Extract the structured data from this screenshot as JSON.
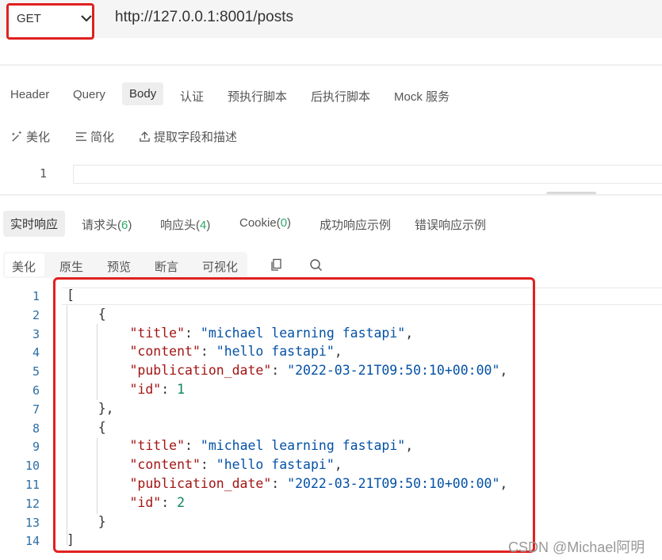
{
  "request": {
    "method": "GET",
    "url": "http://127.0.0.1:8001/posts"
  },
  "request_tabs": [
    "Header",
    "Query",
    "Body",
    "认证",
    "预执行脚本",
    "后执行脚本",
    "Mock 服务"
  ],
  "active_request_tab": "Body",
  "tools": {
    "beautify": "美化",
    "simplify": "简化",
    "extract": "提取字段和描述"
  },
  "request_editor": {
    "line_number": "1"
  },
  "response_tabs": {
    "realtime": "实时响应",
    "request_headers_label": "请求头(",
    "request_headers_count": "6",
    "response_headers_label": "响应头(",
    "response_headers_count": "4",
    "cookie_label": "Cookie(",
    "cookie_count": "0",
    "close_paren": ")",
    "success_example": "成功响应示例",
    "error_example": "错误响应示例"
  },
  "view_tabs": [
    "美化",
    "原生",
    "预览",
    "断言",
    "可视化"
  ],
  "active_view_tab": "美化",
  "icons": [
    "chevron-down-icon",
    "magic-wand-icon",
    "list-icon",
    "upload-icon",
    "copy-icon",
    "search-icon"
  ],
  "response_body": [
    {
      "title": "michael learning fastapi",
      "content": "hello fastapi",
      "publication_date": "2022-03-21T09:50:10+00:00",
      "id": 1
    },
    {
      "title": "michael learning fastapi",
      "content": "hello fastapi",
      "publication_date": "2022-03-21T09:50:10+00:00",
      "id": 2
    }
  ],
  "code_lines": [
    {
      "n": "1",
      "parts": [
        {
          "t": "["
        }
      ]
    },
    {
      "n": "2",
      "parts": [
        {
          "t": "    {"
        }
      ]
    },
    {
      "n": "3",
      "parts": [
        {
          "t": "        "
        },
        {
          "t": "\"title\"",
          "c": "k"
        },
        {
          "t": ": "
        },
        {
          "t": "\"michael learning fastapi\"",
          "c": "s"
        },
        {
          "t": ","
        }
      ]
    },
    {
      "n": "4",
      "parts": [
        {
          "t": "        "
        },
        {
          "t": "\"content\"",
          "c": "k"
        },
        {
          "t": ": "
        },
        {
          "t": "\"hello fastapi\"",
          "c": "s"
        },
        {
          "t": ","
        }
      ]
    },
    {
      "n": "5",
      "parts": [
        {
          "t": "        "
        },
        {
          "t": "\"publication_date\"",
          "c": "k"
        },
        {
          "t": ": "
        },
        {
          "t": "\"2022-03-21T09:50:10+00:00\"",
          "c": "s"
        },
        {
          "t": ","
        }
      ]
    },
    {
      "n": "6",
      "parts": [
        {
          "t": "        "
        },
        {
          "t": "\"id\"",
          "c": "k"
        },
        {
          "t": ": "
        },
        {
          "t": "1",
          "c": "n"
        }
      ]
    },
    {
      "n": "7",
      "parts": [
        {
          "t": "    },"
        }
      ]
    },
    {
      "n": "8",
      "parts": [
        {
          "t": "    {"
        }
      ]
    },
    {
      "n": "9",
      "parts": [
        {
          "t": "        "
        },
        {
          "t": "\"title\"",
          "c": "k"
        },
        {
          "t": ": "
        },
        {
          "t": "\"michael learning fastapi\"",
          "c": "s"
        },
        {
          "t": ","
        }
      ]
    },
    {
      "n": "10",
      "parts": [
        {
          "t": "        "
        },
        {
          "t": "\"content\"",
          "c": "k"
        },
        {
          "t": ": "
        },
        {
          "t": "\"hello fastapi\"",
          "c": "s"
        },
        {
          "t": ","
        }
      ]
    },
    {
      "n": "11",
      "parts": [
        {
          "t": "        "
        },
        {
          "t": "\"publication_date\"",
          "c": "k"
        },
        {
          "t": ": "
        },
        {
          "t": "\"2022-03-21T09:50:10+00:00\"",
          "c": "s"
        },
        {
          "t": ","
        }
      ]
    },
    {
      "n": "12",
      "parts": [
        {
          "t": "        "
        },
        {
          "t": "\"id\"",
          "c": "k"
        },
        {
          "t": ": "
        },
        {
          "t": "2",
          "c": "n"
        }
      ]
    },
    {
      "n": "13",
      "parts": [
        {
          "t": "    }"
        }
      ]
    },
    {
      "n": "14",
      "parts": [
        {
          "t": "]"
        }
      ]
    }
  ],
  "colors": {
    "highlight": "#e02020",
    "json_key": "#a31515",
    "json_string": "#0451a5",
    "json_number": "#098658",
    "count": "#2aa86a"
  },
  "watermark": "CSDN @Michael阿明"
}
